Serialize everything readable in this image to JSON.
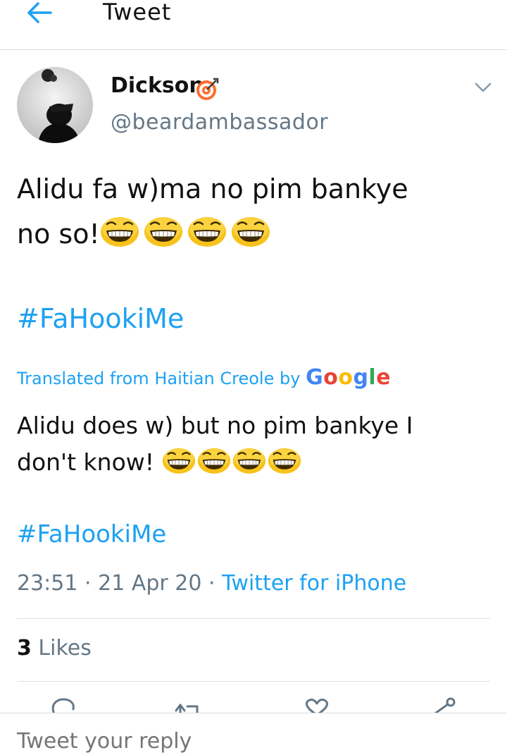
{
  "header": {
    "title": "Tweet",
    "back_icon": "arrow-left-icon"
  },
  "author": {
    "name": "Dickson",
    "badge_icon": "bullseye-icon",
    "handle": "@beardambassador"
  },
  "tweet": {
    "text_line1": "Alidu fa w)ma no pim bankye",
    "text_line2": "no so!",
    "emoji": "grinning-squinting-face-icon",
    "emoji_count": 4,
    "hashtag": "#FaHookiMe"
  },
  "translation": {
    "label": "Translated from Haitian Creole by",
    "provider": "Google",
    "provider_colors": [
      "#4285F4",
      "#EA4335",
      "#FBBC05",
      "#4285F4",
      "#34A853",
      "#EA4335"
    ],
    "text_line1": "Alidu does w) but no pim bankye I",
    "text_line2": "don't know!",
    "hashtag": "#FaHookiMe"
  },
  "meta": {
    "time": "23:51",
    "date": "21 Apr 20",
    "separator": "·",
    "source": "Twitter for iPhone"
  },
  "stats": {
    "likes_count": "3",
    "likes_label": "Likes"
  },
  "actions": [
    "reply-icon",
    "retweet-icon",
    "like-icon",
    "share-icon"
  ],
  "reply": {
    "placeholder": "Tweet your reply"
  },
  "colors": {
    "accent": "#1da1f2",
    "secondary_text": "#657786",
    "divider": "#d6dfe5"
  }
}
